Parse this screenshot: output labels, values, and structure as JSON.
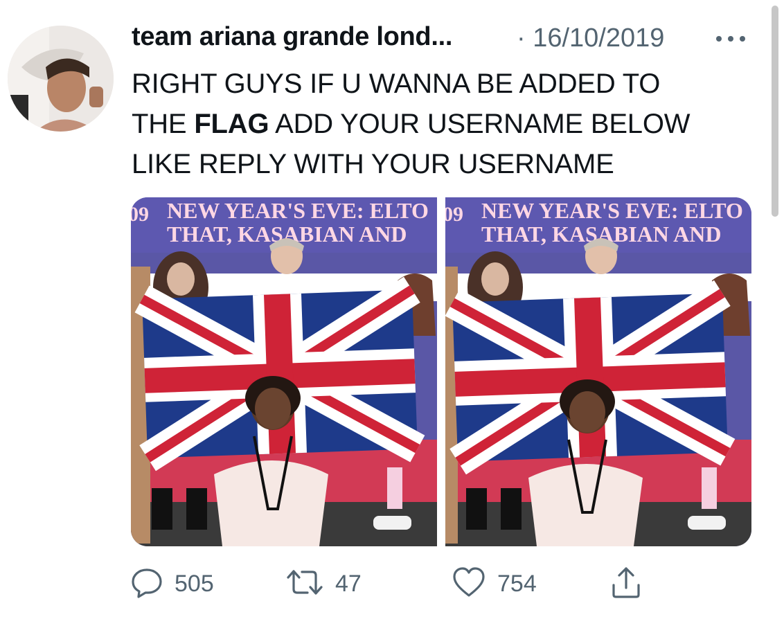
{
  "tweet": {
    "author_name": "team ariana grande lond...",
    "separator": "·",
    "date": "16/10/2019",
    "text_line1": "RIGHT GUYS IF U WANNA BE ADDED TO",
    "text_line2_pre": "THE ",
    "text_line2_bold": "FLAG",
    "text_line2_post": " ADD YOUR USERNAME BELOW",
    "text_line3": "LIKE REPLY WITH YOUR USERNAME"
  },
  "media": {
    "banner_line1": "NEW YEAR'S EVE: ELTO",
    "banner_line2": "THAT, KASABIAN AND",
    "banner_left_edge": "09"
  },
  "actions": {
    "replies": "505",
    "retweets": "47",
    "likes": "754"
  },
  "icons": {
    "more": "more-horizontal-icon",
    "reply": "reply-icon",
    "retweet": "retweet-icon",
    "like": "heart-icon",
    "share": "share-icon"
  },
  "colors": {
    "text": "#0f1419",
    "secondary": "#536471",
    "flag_blue": "#1e3a8a",
    "flag_red": "#cf2337",
    "backdrop": "#5a57a6"
  }
}
